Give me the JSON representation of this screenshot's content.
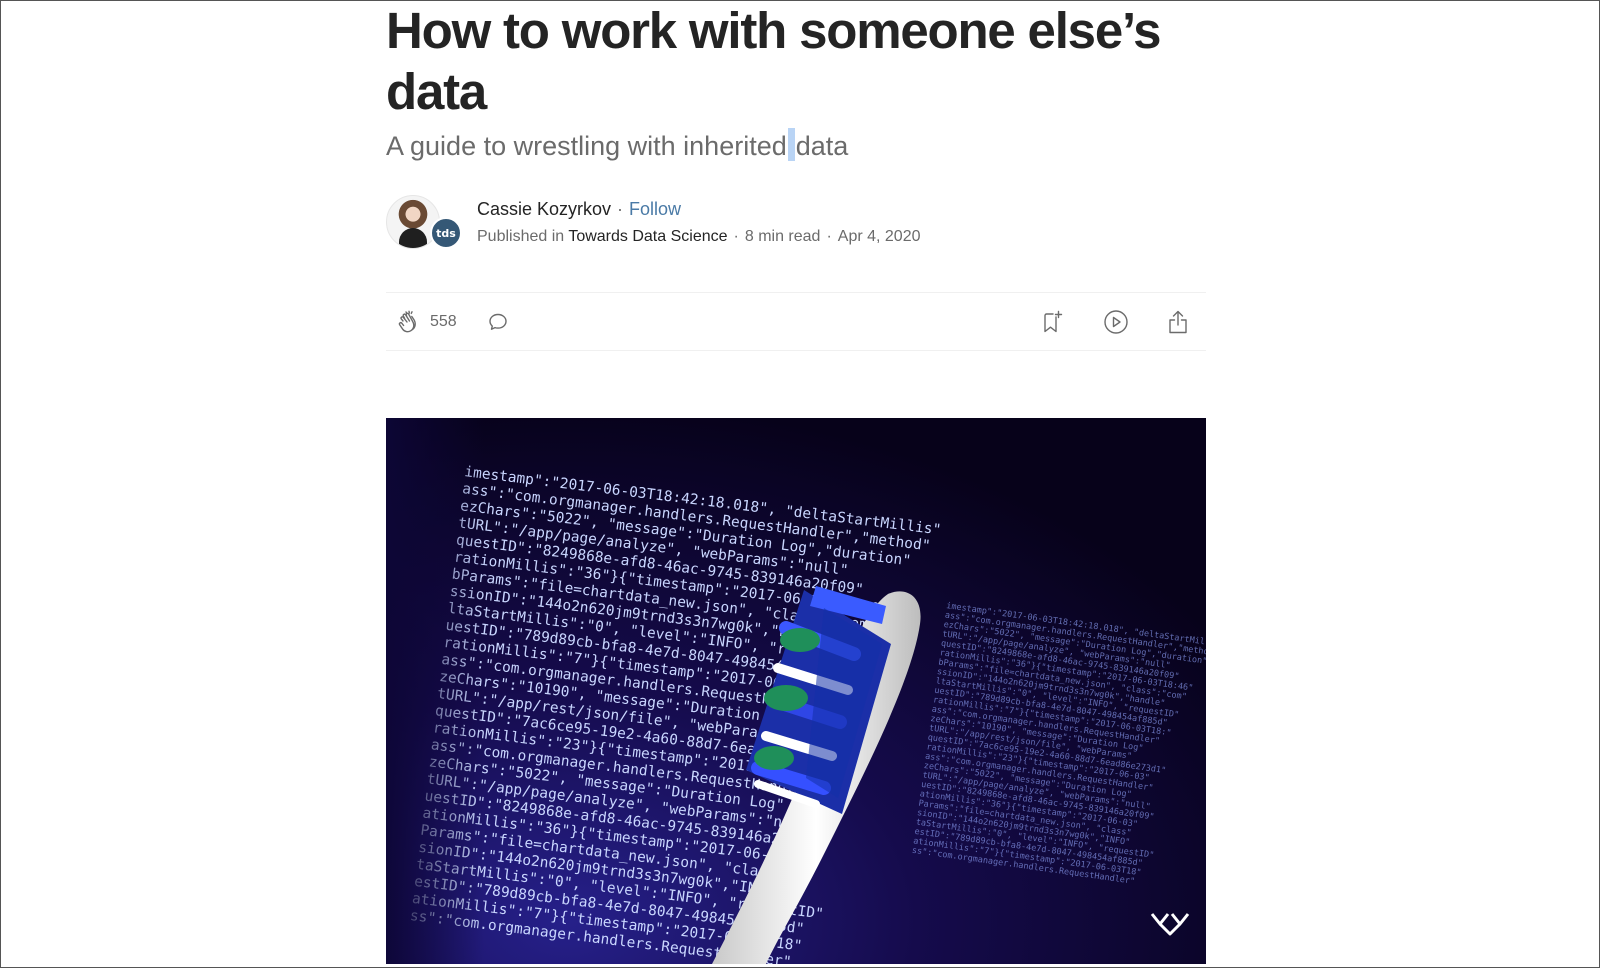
{
  "article": {
    "title": "How to work with someone else’s data",
    "subtitle_before": "A guide to wrestling with inherited",
    "subtitle_after": "data"
  },
  "author": {
    "name": "Cassie Kozyrkov",
    "follow_label": "Follow",
    "published_in_label": "Published in",
    "publication": "Towards Data Science",
    "publication_badge": "tds",
    "read_time": "8 min read",
    "date": "Apr 4, 2020",
    "separator": "·"
  },
  "actions": {
    "clap_count": "558"
  },
  "hero": {
    "code_lines": [
      "imestamp\":\"2017-06-03T18:42:18.018\", \"deltaStartMillis\"",
      "ass\":\"com.orgmanager.handlers.RequestHandler\",\"method\"",
      "ezChars\":\"5022\", \"message\":\"Duration Log\",\"duration\"",
      "tURL\":\"/app/page/analyze\", \"webParams\":\"null\"",
      "questID\":\"8249868e-afd8-46ac-9745-839146a20f09\"",
      "rationMillis\":\"36\"}{\"timestamp\":\"2017-06-03T18:46\"",
      "bParams\":\"file=chartdata_new.json\", \"class\":\"com\"",
      "ssionID\":\"144o2n620jm9trnd3s3n7wg0k\",\"handle\"",
      "ltaStartMillis\":\"0\", \"level\":\"INFO\", \"requestID\"",
      "uestID\":\"789d89cb-bfa8-4e7d-8047-498454af885d\"",
      "rationMillis\":\"7\"}{\"timestamp\":\"2017-06-03T18:\"",
      "ass\":\"com.orgmanager.handlers.RequestHandler\"",
      "zeChars\":\"10190\", \"message\":\"Duration Log\"",
      "tURL\":\"/app/rest/json/file\", \"webParams\"",
      "questID\":\"7ac6ce95-19e2-4a60-88d7-6ead86e273d1\"",
      "rationMillis\":\"23\"}{\"timestamp\":\"2017-06-03\"",
      "ass\":\"com.orgmanager.handlers.RequestHandler\"",
      "zeChars\":\"5022\", \"message\":\"Duration Log\"",
      "tURL\":\"/app/page/analyze\", \"webParams\":\"null\"",
      "uestID\":\"8249868e-afd8-46ac-9745-839146a20f09\"",
      "ationMillis\":\"36\"}{\"timestamp\":\"2017-06-03\"",
      "Params\":\"file=chartdata_new.json\", \"class\"",
      "sionID\":\"144o2n620jm9trnd3s3n7wg0k\",\"INFO\"",
      "taStartMillis\":\"0\", \"level\":\"INFO\", \"requestID\"",
      "estID\":\"789d89cb-bfa8-4e7d-8047-498454af885d\"",
      "ationMillis\":\"7\"}{\"timestamp\":\"2017-06-03T18\"",
      "ss\":\"com.orgmanager.handlers.RequestHandler\""
    ]
  }
}
